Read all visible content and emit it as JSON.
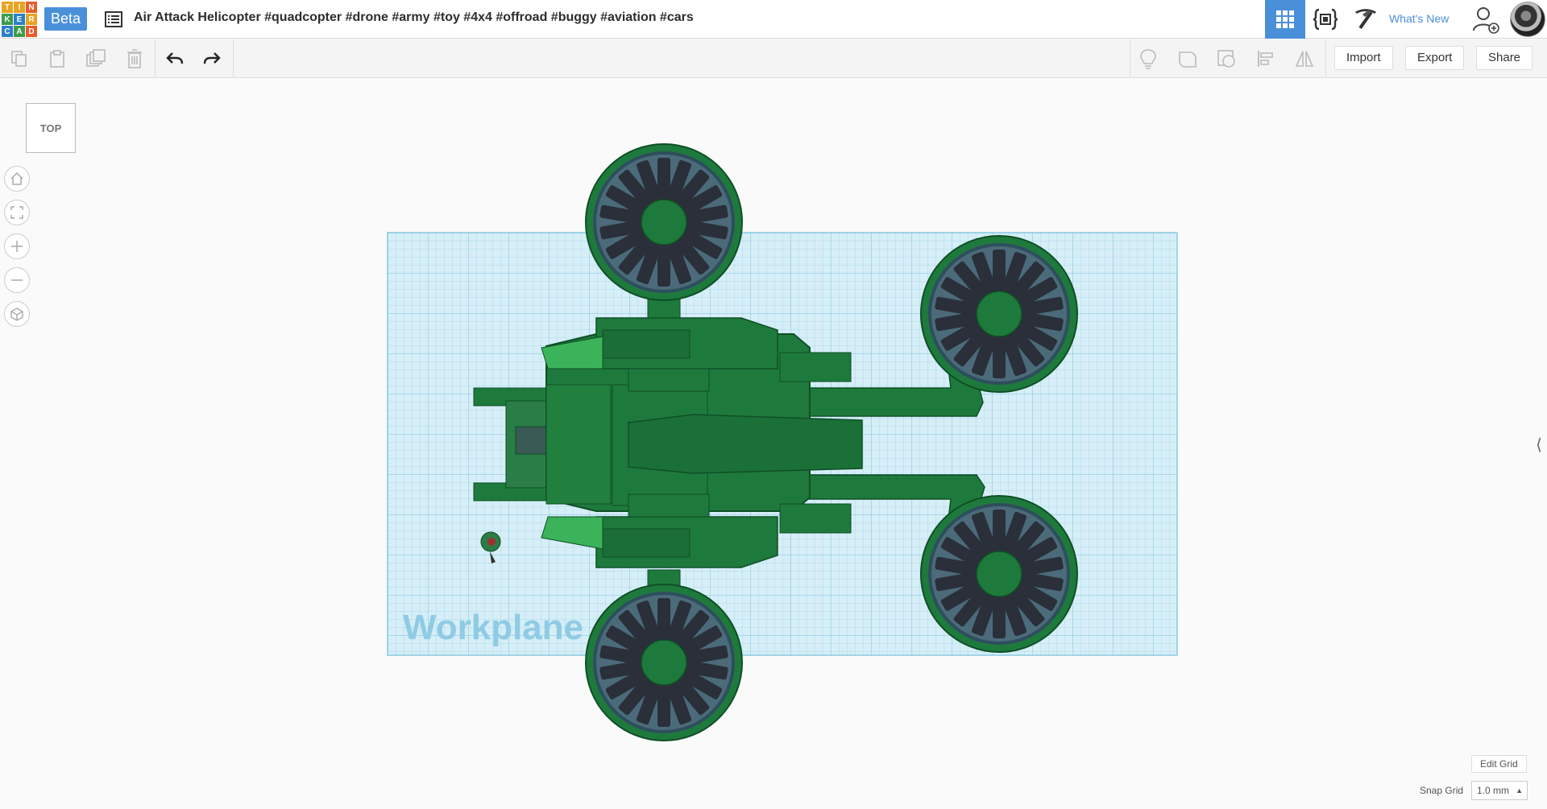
{
  "app": {
    "logo_letters": [
      "T",
      "I",
      "N",
      "K",
      "E",
      "R",
      "C",
      "A",
      "D"
    ],
    "logo_colors": [
      "#e8a320",
      "#e8a320",
      "#e8a320",
      "#3d9b4c",
      "#3d9b4c",
      "#3d9b4c",
      "#2c7fc9",
      "#2c7fc9",
      "#2c7fc9"
    ],
    "beta_label": "Beta",
    "design_title": "Air Attack Helicopter #quadcopter #drone #army #toy #4x4 #offroad #buggy #aviation #cars",
    "whats_new": "What's New"
  },
  "toolbar": {
    "import_label": "Import",
    "export_label": "Export",
    "share_label": "Share"
  },
  "viewcube": {
    "face_label": "TOP"
  },
  "workplane": {
    "label": "Workplane"
  },
  "grid_settings": {
    "edit_grid_label": "Edit Grid",
    "snap_grid_label": "Snap Grid",
    "snap_grid_value": "1.0 mm"
  },
  "colors": {
    "accent": "#4a90d9",
    "model_green": "#1e7a3c",
    "workplane_blue": "#bfe3f0"
  }
}
